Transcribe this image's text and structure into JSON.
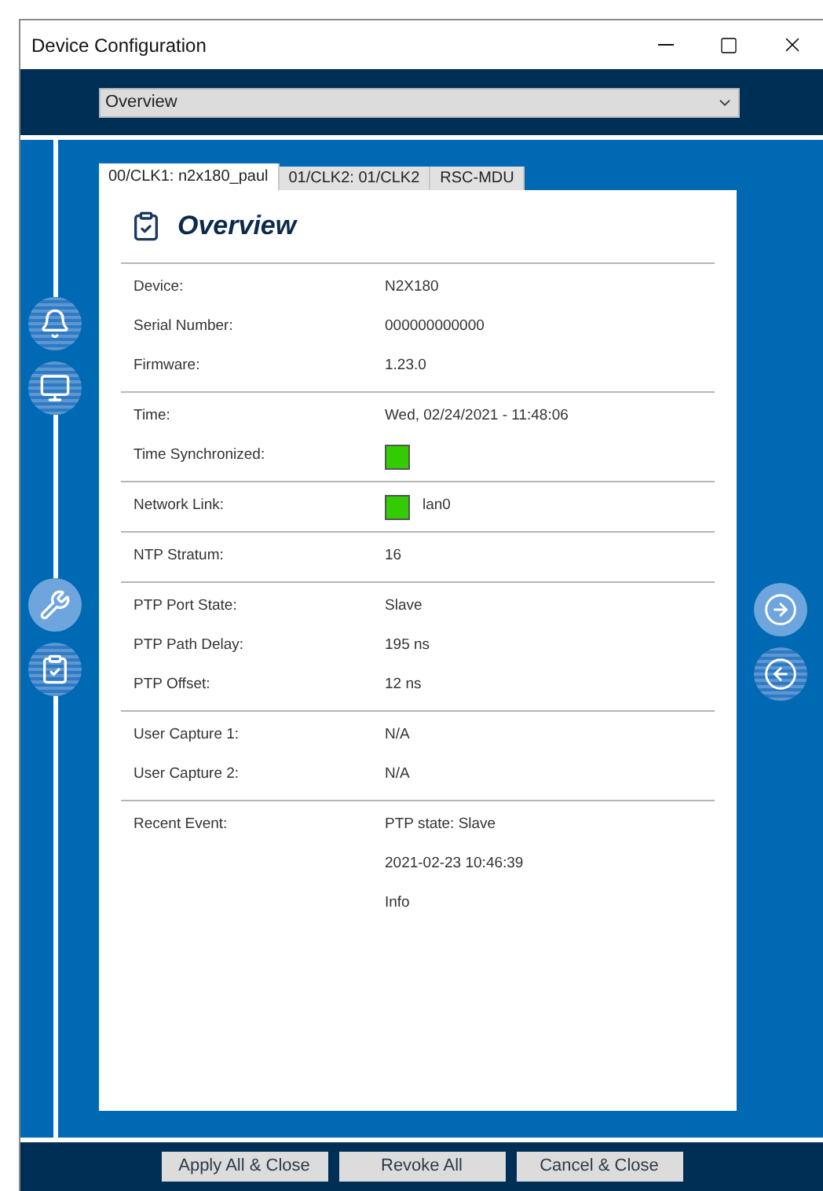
{
  "window": {
    "title": "Device Configuration"
  },
  "view_select": {
    "value": "Overview"
  },
  "tabs": [
    {
      "label": "00/CLK1: n2x180_paul",
      "selected": true
    },
    {
      "label": "01/CLK2: 01/CLK2",
      "selected": false
    },
    {
      "label": "RSC-MDU",
      "selected": false
    }
  ],
  "left_nav": [
    {
      "selected": false
    },
    {
      "selected": false
    },
    {
      "selected": true
    },
    {
      "selected": false
    }
  ],
  "right_nav": [
    {
      "disabled": false
    },
    {
      "disabled": true
    }
  ],
  "panel": {
    "title": "Overview",
    "groups": [
      {
        "rows": [
          {
            "label": "Device:",
            "kind": "text",
            "values": [
              "N2X180"
            ]
          },
          {
            "label": "Serial Number:",
            "kind": "text",
            "values": [
              "000000000000"
            ]
          },
          {
            "label": "Firmware:",
            "kind": "text",
            "values": [
              "1.23.0"
            ]
          }
        ]
      },
      {
        "rows": [
          {
            "label": "Time:",
            "kind": "text",
            "values": [
              "Wed, 02/24/2021 - 11:48:06"
            ]
          },
          {
            "label": "Time Synchronized:",
            "kind": "indicator",
            "on": true,
            "values": []
          }
        ]
      },
      {
        "rows": [
          {
            "label": "Network Link:",
            "kind": "indicator",
            "on": true,
            "values": [
              "lan0"
            ]
          }
        ]
      },
      {
        "rows": [
          {
            "label": "NTP Stratum:",
            "kind": "text",
            "values": [
              "16"
            ]
          }
        ]
      },
      {
        "rows": [
          {
            "label": "PTP Port State:",
            "kind": "text",
            "values": [
              "Slave"
            ]
          },
          {
            "label": "PTP Path Delay:",
            "kind": "text",
            "values": [
              "195 ns"
            ]
          },
          {
            "label": "PTP Offset:",
            "kind": "text",
            "values": [
              "12 ns"
            ]
          }
        ]
      },
      {
        "rows": [
          {
            "label": "User Capture 1:",
            "kind": "text",
            "values": [
              "N/A"
            ]
          },
          {
            "label": "User Capture 2:",
            "kind": "text",
            "values": [
              "N/A"
            ]
          }
        ]
      },
      {
        "rows": [
          {
            "label": "Recent Event:",
            "kind": "text",
            "values": [
              "PTP state: Slave",
              "2021-02-23 10:46:39",
              "Info"
            ]
          }
        ]
      }
    ]
  },
  "buttons": [
    "Apply All & Close",
    "Revoke All",
    "Cancel & Close"
  ]
}
